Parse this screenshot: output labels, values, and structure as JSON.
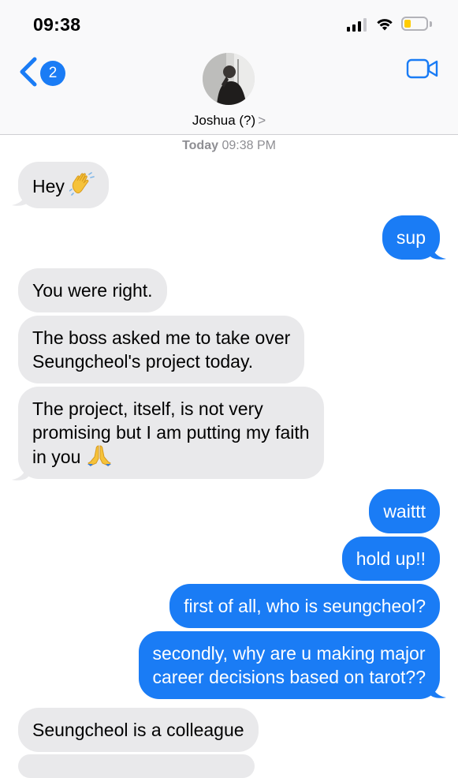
{
  "status_bar": {
    "time": "09:38"
  },
  "header": {
    "back_badge_count": "2",
    "contact_name": "Joshua (?)",
    "chevron": ">"
  },
  "conversation": {
    "date_label": "Today",
    "time_label": "09:38 PM",
    "messages": [
      {
        "from": "them",
        "text": "Hey",
        "emoji": "waving-hand"
      },
      {
        "from": "me",
        "text": "sup"
      },
      {
        "from": "them",
        "text": "You were right."
      },
      {
        "from": "them",
        "text_lines": [
          "The boss asked me to take over",
          "Seungcheol's project today."
        ]
      },
      {
        "from": "them",
        "text_lines": [
          "The project, itself, is not very",
          "promising but I am putting my faith",
          "in you"
        ],
        "emoji": "folded-hands"
      },
      {
        "from": "me",
        "text": "waittt"
      },
      {
        "from": "me",
        "text": "hold up!!"
      },
      {
        "from": "me",
        "text": "first of all, who is seungcheol?"
      },
      {
        "from": "me",
        "text_lines": [
          "secondly, why are u making major",
          "career decisions based on tarot??"
        ]
      },
      {
        "from": "them",
        "text": "Seungcheol is a colleague"
      }
    ]
  },
  "colors": {
    "outgoing_bubble": "#1a7cf5",
    "incoming_bubble": "#e9e9eb",
    "header_bg": "#f9f9fa",
    "timestamp": "#8e8e93",
    "battery_fill": "#ffcc00"
  }
}
